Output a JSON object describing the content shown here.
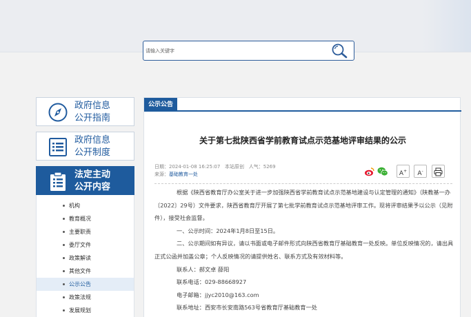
{
  "search": {
    "placeholder": "请输入关键字"
  },
  "sidebar": {
    "cards": [
      {
        "line1": "政府信息",
        "line2": "公开指南",
        "icon": "compass-icon"
      },
      {
        "line1": "政府信息",
        "line2": "公开制度",
        "icon": "document-list-icon"
      },
      {
        "line1": "法定主动",
        "line2": "公开内容",
        "icon": "clipboard-list-icon"
      }
    ],
    "items": [
      {
        "label": "机构"
      },
      {
        "label": "教育概况"
      },
      {
        "label": "主要职责"
      },
      {
        "label": "委厅文件"
      },
      {
        "label": "政策解读"
      },
      {
        "label": "其他文件"
      },
      {
        "label": "公示公告"
      },
      {
        "label": "政策法规"
      },
      {
        "label": "发展规划"
      }
    ],
    "active_item": "公示公告"
  },
  "main": {
    "tag": "公示公告",
    "title": "关于第七批陕西省学前教育试点示范基地评审结果的公示",
    "meta": {
      "date_label": "日期：",
      "date": "2024-01-08 16:25:07",
      "site_label": "本站原创",
      "views_label": "人气：",
      "views": "5269",
      "source_label": "来源：",
      "source": "基础教育一处"
    },
    "tools": {
      "font_up": "A",
      "font_down": "A",
      "print_icon": "printer-icon",
      "share_weibo": "weibo-icon",
      "share_wechat": "wechat-icon"
    },
    "paragraphs": [
      "根据《陕西省教育厅办公室关于进一步加强陕西省学前教育试点示范基地建设与认定管理的通知》（陕教基一办〔2022〕29号）文件要求，陕西省教育厅开展了第七批学前教育试点示范基地评审工作。现将评审结果予以公示（见附件），接受社会监督。",
      "一、公示时间：2024年1月8日至15日。",
      "二、公示期间如有异议，请以书面或电子邮件形式向陕西省教育厅基础教育一处反映。单位反映情况的，请出具正式公函并加盖公章；个人反映情况的请提供姓名、联系方式及有效材料等。"
    ],
    "contacts": [
      "联系人：郝文卓 薛阳",
      "联系电话：029-88668927",
      "电子邮箱：jjyc2010@163.com",
      "联系地址：西安市长安南路563号省教育厅基础教育一处"
    ]
  },
  "colors": {
    "brand": "#1e5b9d",
    "accent_link": "#1f5a9e"
  }
}
